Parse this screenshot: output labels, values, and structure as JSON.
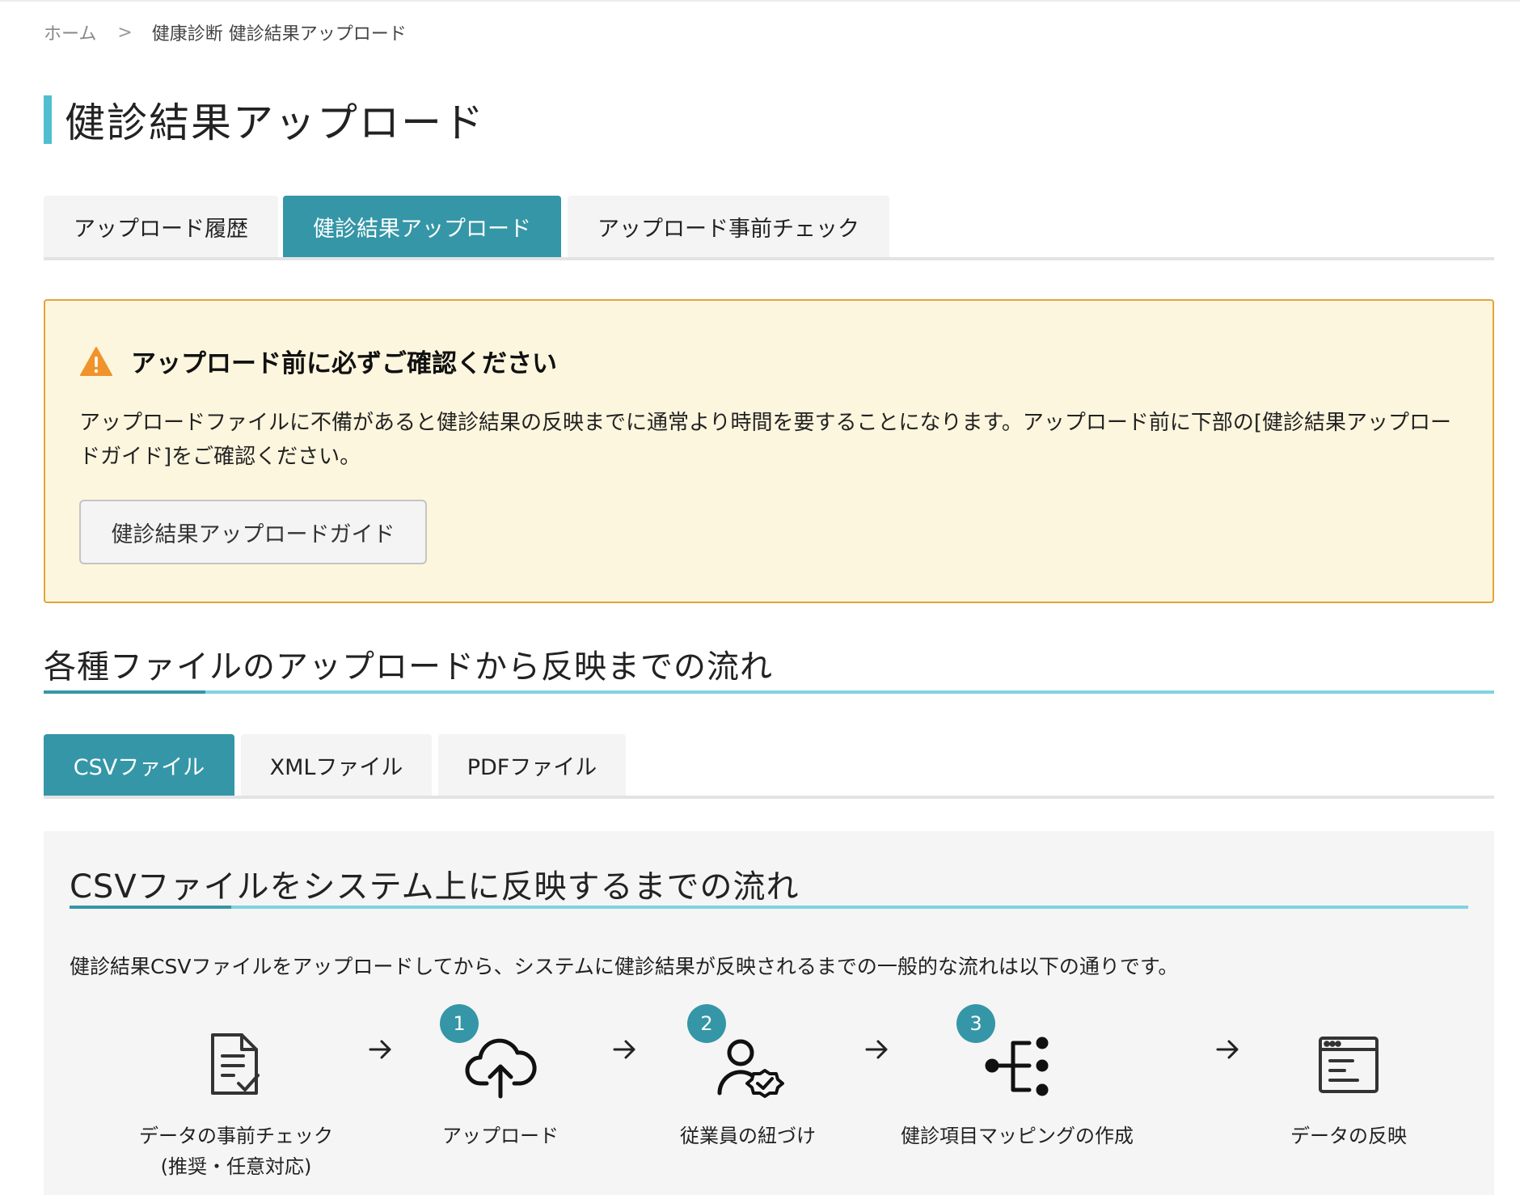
{
  "breadcrumb": {
    "home": "ホーム",
    "separator": ">",
    "current": "健康診断 健診結果アップロード"
  },
  "page": {
    "title": "健診結果アップロード"
  },
  "main_tabs": [
    {
      "label": "アップロード履歴",
      "active": false
    },
    {
      "label": "健診結果アップロード",
      "active": true
    },
    {
      "label": "アップロード事前チェック",
      "active": false
    }
  ],
  "notice": {
    "icon": "warning-icon",
    "title": "アップロード前に必ずご確認ください",
    "body": "アップロードファイルに不備があると健診結果の反映までに通常より時間を要することになります。アップロード前に下部の[健診結果アップロードガイド]をご確認ください。",
    "button_label": "健診結果アップロードガイド"
  },
  "section": {
    "title": "各種ファイルのアップロードから反映までの流れ"
  },
  "file_tabs": [
    {
      "label": "CSVファイル",
      "active": true
    },
    {
      "label": "XMLファイル",
      "active": false
    },
    {
      "label": "PDFファイル",
      "active": false
    }
  ],
  "panel": {
    "title": "CSVファイルをシステム上に反映するまでの流れ",
    "description": "健診結果CSVファイルをアップロードしてから、システムに健診結果が反映されるまでの一般的な流れは以下の通りです。",
    "steps": [
      {
        "label_line1": "データの事前チェック",
        "label_line2": "(推奨・任意対応)",
        "badge": "",
        "icon": "document-check-icon"
      },
      {
        "label_line1": "アップロード",
        "label_line2": "",
        "badge": "1",
        "icon": "cloud-upload-icon"
      },
      {
        "label_line1": "従業員の紐づけ",
        "label_line2": "",
        "badge": "2",
        "icon": "user-check-icon"
      },
      {
        "label_line1": "健診項目マッピングの作成",
        "label_line2": "",
        "badge": "3",
        "icon": "mapping-tree-icon"
      },
      {
        "label_line1": "データの反映",
        "label_line2": "",
        "badge": "",
        "icon": "browser-window-icon"
      }
    ]
  },
  "colors": {
    "accent": "#3596a7",
    "accent_light": "#7fd3e2",
    "title_bar": "#4fbfd0",
    "notice_bg": "#fdf6de",
    "notice_border": "#e5a23a",
    "warning": "#f0932b"
  }
}
